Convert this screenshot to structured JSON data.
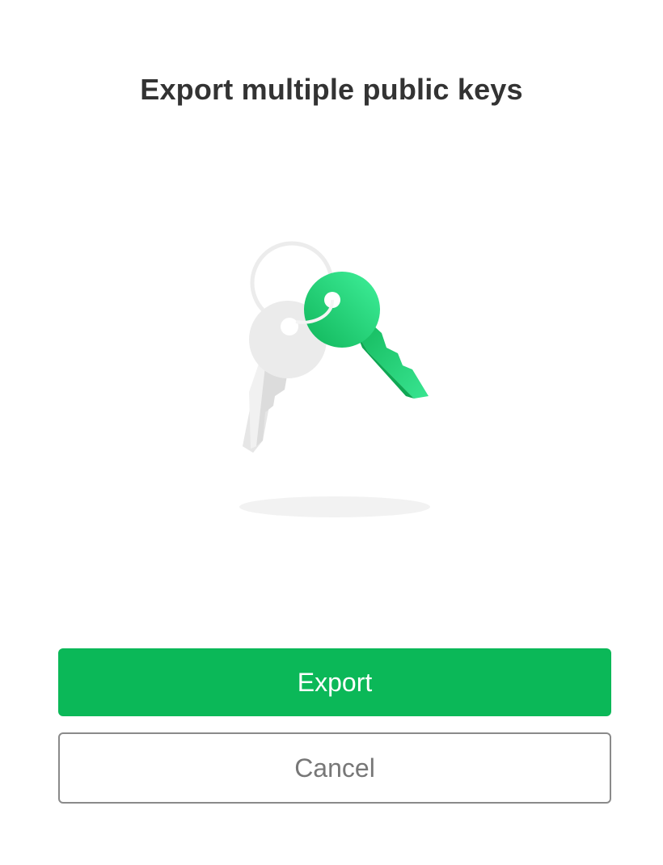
{
  "dialog": {
    "title": "Export multiple public keys",
    "illustration_icon": "keyring-icon",
    "primary_button": {
      "label": "Export",
      "color": "#0bb858"
    },
    "secondary_button": {
      "label": "Cancel"
    }
  }
}
